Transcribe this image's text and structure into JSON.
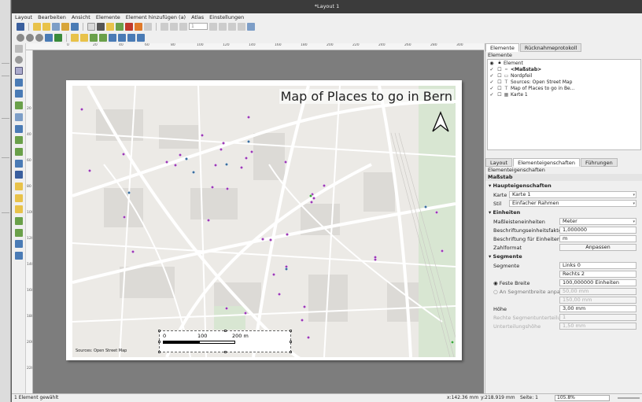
{
  "window": {
    "title": "*Layout 1"
  },
  "menu": [
    "Layout",
    "Bearbeiten",
    "Ansicht",
    "Elemente",
    "Element hinzufügen (a)",
    "Atlas",
    "Einstellungen"
  ],
  "toolbar": {
    "page_field": "1"
  },
  "ruler": {
    "h_ticks": [
      "0",
      "20",
      "40",
      "60",
      "80",
      "100",
      "120",
      "140",
      "160",
      "180",
      "200",
      "220",
      "240",
      "260",
      "280",
      "300"
    ],
    "v_ticks": [
      "20",
      "40",
      "60",
      "80",
      "100",
      "120",
      "140",
      "160",
      "180",
      "200",
      "220"
    ]
  },
  "map": {
    "title": "Map of Places to go in Bern",
    "source": "Sources: Open Street Map",
    "scalebar": {
      "labels": [
        "0",
        "100",
        "200 m"
      ]
    },
    "colors": {
      "poi_purple": "#9b3ab5",
      "poi_blue": "#3a6e9e",
      "poi_green": "#3aa63a",
      "road": "#ffffff",
      "block": "#dcdad6",
      "green_area": "#d8e6d2"
    }
  },
  "panel": {
    "top_tabs": [
      "Elemente",
      "Rücknahmeprotokoll"
    ],
    "items_title": "Elemente",
    "items_header": "Element",
    "items": [
      {
        "label": "<Maßstab>",
        "icon": "scale-icon",
        "bold": true
      },
      {
        "label": "Nordpfeil",
        "icon": "north-arrow-icon",
        "bold": false
      },
      {
        "label": "Sources: Open Street Map",
        "icon": "label-icon",
        "bold": false
      },
      {
        "label": "Map of Places to go in Be...",
        "icon": "label-icon",
        "bold": false
      },
      {
        "label": "Karte 1",
        "icon": "map-icon",
        "bold": false
      }
    ],
    "bottom_tabs": [
      "Layout",
      "Elementeigenschaften",
      "Führungen"
    ],
    "props_title": "Elementeigenschaften",
    "element_type": "Maßstab",
    "sections": {
      "main": "Haupteigenschaften",
      "units": "Einheiten",
      "segments": "Segmente"
    },
    "main": {
      "map_label": "Karte",
      "map_value": "Karte 1",
      "style_label": "Stil",
      "style_value": "Einfacher Rahmen"
    },
    "units": {
      "unit_label": "Maßleisteneinheiten",
      "unit_value": "Meter",
      "factor_label": "Beschriftungseinheitsfaktor",
      "factor_value": "1,000000",
      "labelunits_label": "Beschriftung für Einheiten",
      "labelunits_value": "m",
      "numformat_label": "Zahlformat",
      "numformat_button": "Anpassen"
    },
    "segments": {
      "segments_label": "Segmente",
      "left_value": "Links 0",
      "right_value": "Rechts 2",
      "fixed_width_label": "Feste Breite",
      "fixed_width_value": "100,000000 Einheiten",
      "fit_width_label": "An Segmentbreite anpassen",
      "fit_min": "50,00 mm",
      "fit_max": "150,00 mm",
      "height_label": "Höhe",
      "height_value": "3,00 mm",
      "right_subdiv_label": "Rechte Segmentunterteilungen",
      "right_subdiv_value": "1",
      "subdiv_height_label": "Unterteilungshöhe",
      "subdiv_height_value": "1,50 mm"
    }
  },
  "status": {
    "left": "1 Element gewählt",
    "coords_x": "x:142.36 mm",
    "coords_y": "y:218.919 mm",
    "page": "Seite: 1",
    "zoom": "105.8%"
  }
}
